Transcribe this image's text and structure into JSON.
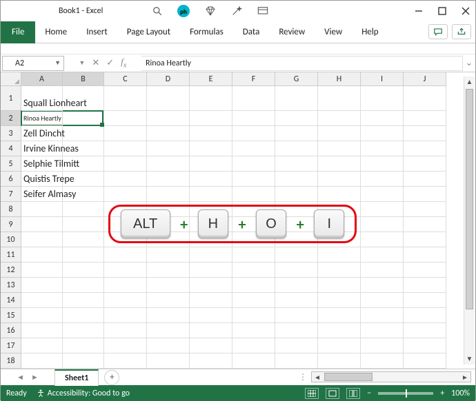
{
  "title": "Book1  -  Excel",
  "ribbon": {
    "file": "File",
    "tabs": [
      "Home",
      "Insert",
      "Page Layout",
      "Formulas",
      "Data",
      "Review",
      "View",
      "Help"
    ]
  },
  "namebox": {
    "value": "A2"
  },
  "formula_bar": {
    "value": "Rinoa Heartly"
  },
  "columns": [
    "A",
    "B",
    "C",
    "D",
    "E",
    "F",
    "G",
    "H",
    "I",
    "J"
  ],
  "sheet": {
    "active_row": 2,
    "rows_visible": 18,
    "data": {
      "1": "Squall Lionheart",
      "2": "Rinoa Heartly",
      "3": "Zell Dincht",
      "4": "Irvine Kinneas",
      "5": "Selphie Tilmitt",
      "6": "Quistis Trepe",
      "7": "Seifer Almasy"
    }
  },
  "overlay_keys": {
    "k0": "ALT",
    "k1": "H",
    "k2": "O",
    "k3": "I",
    "plus": "+"
  },
  "sheettab": {
    "name": "Sheet1"
  },
  "statusbar": {
    "ready": "Ready",
    "accessibility": "Accessibility: Good to go",
    "zoom": "100%",
    "minus": "−",
    "plus": "+"
  }
}
